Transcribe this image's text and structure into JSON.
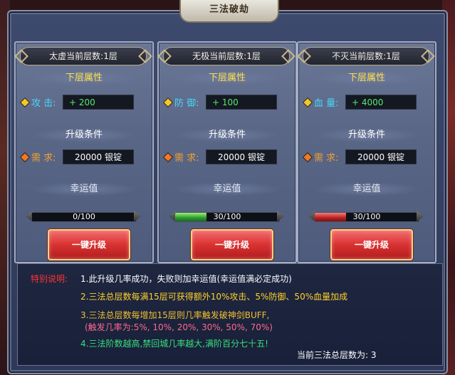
{
  "title": "三法破劫",
  "columns": [
    {
      "header": "太虚当前层数:1层",
      "next_attr_title": "下层属性",
      "attr_label": "攻 击:",
      "attr_value": "+ 200",
      "cond_title": "升级条件",
      "req_label": "需 求:",
      "req_value": "20000 银锭",
      "luck_title": "幸运值",
      "luck_text": "0/100",
      "luck_value": 0,
      "luck_max": 100,
      "bar_color": "#2a9a30",
      "button_label": "一键升级"
    },
    {
      "header": "无极当前层数:1层",
      "next_attr_title": "下层属性",
      "attr_label": "防 御:",
      "attr_value": "+ 100",
      "cond_title": "升级条件",
      "req_label": "需 求:",
      "req_value": "20000 银锭",
      "luck_title": "幸运值",
      "luck_text": "30/100",
      "luck_value": 30,
      "luck_max": 100,
      "bar_color": "#2a9a30",
      "button_label": "一键升级"
    },
    {
      "header": "不灭当前层数:1层",
      "next_attr_title": "下层属性",
      "attr_label": "血 量:",
      "attr_value": "+ 4000",
      "cond_title": "升级条件",
      "req_label": "需 求:",
      "req_value": "20000 银锭",
      "luck_title": "幸运值",
      "luck_text": "30/100",
      "luck_value": 30,
      "luck_max": 100,
      "bar_color": "#b82020",
      "button_label": "一键升级"
    }
  ],
  "info": {
    "label": "特别说明:",
    "line1": "1.此升级几率成功，失败则加幸运值(幸运值满必定成功)",
    "line2": "2.三法总层数每满15层可获得额外10%攻击、5%防御、50%血量加成",
    "line3a": "3.三法总层数每增加15层则几率触发破神剑BUFF,",
    "line3b": "(触发几率为:5%, 10%, 20%, 30%, 50%, 70%)",
    "line4": "4.三法阶数越高,禁回城几率越大,满阶百分七十五!",
    "total": "当前三法总层数为: 3"
  },
  "icons": {
    "attr_marker": "gold-diamond-icon",
    "req_marker": "orange-diamond-icon"
  }
}
